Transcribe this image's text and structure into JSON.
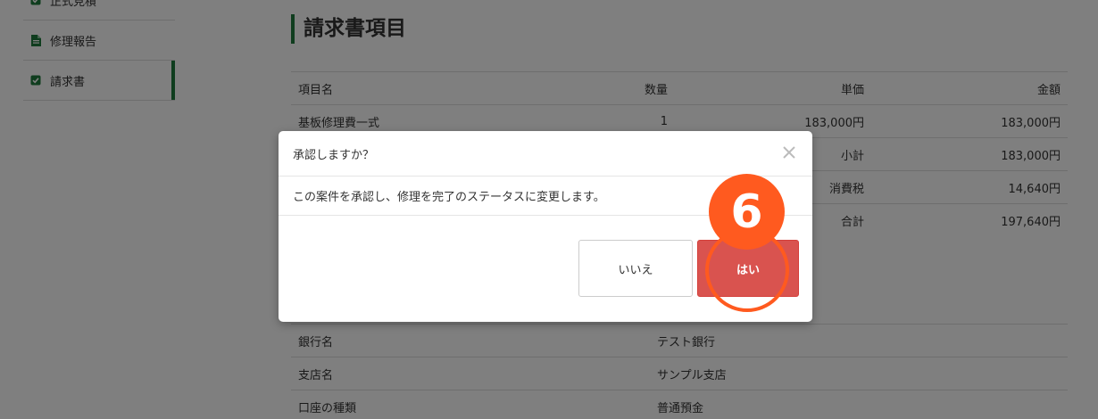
{
  "sidebar": {
    "items": [
      {
        "label": "正式見積",
        "icon": "check-square-icon"
      },
      {
        "label": "修理報告",
        "icon": "document-icon"
      },
      {
        "label": "請求書",
        "icon": "check-square-icon",
        "active": true
      }
    ]
  },
  "page": {
    "title": "請求書項目"
  },
  "invoice_table": {
    "headers": [
      "項目名",
      "数量",
      "単価",
      "金額"
    ],
    "rows": [
      [
        "基板修理費一式",
        "1",
        "183,000円",
        "183,000円"
      ]
    ],
    "summary": [
      {
        "label": "小計",
        "value": "183,000円"
      },
      {
        "label": "消費税",
        "value": "14,640円"
      },
      {
        "label": "合計",
        "value": "197,640円"
      }
    ]
  },
  "bank_table": {
    "rows": [
      [
        "銀行名",
        "テスト銀行"
      ],
      [
        "支店名",
        "サンプル支店"
      ],
      [
        "口座の種類",
        "普通預金"
      ]
    ]
  },
  "modal": {
    "title": "承認しますか？",
    "message": "この案件を承認し、修理を完了のステータスに変更します。",
    "no_label": "いいえ",
    "yes_label": "はい",
    "close_glyph": "×"
  },
  "annotation": {
    "step": "6"
  },
  "colors": {
    "accent": "#1e7a3c",
    "danger": "#d9534f",
    "marker": "#ff5a1f"
  }
}
